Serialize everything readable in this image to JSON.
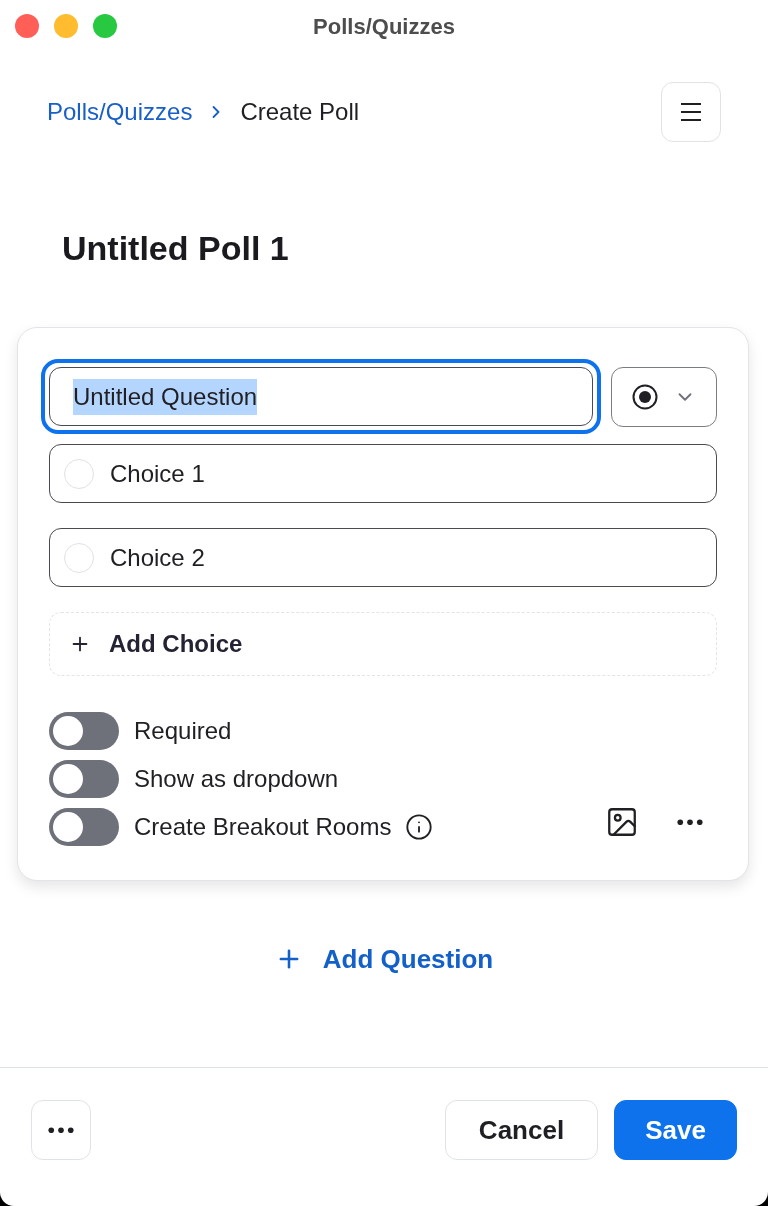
{
  "window": {
    "title": "Polls/Quizzes"
  },
  "breadcrumb": [
    {
      "label": "Polls/Quizzes",
      "kind": "link"
    },
    {
      "label": "Create Poll",
      "kind": "current"
    }
  ],
  "poll_title": "Untitled Poll 1",
  "question": {
    "value": "Untitled Question",
    "focused": true,
    "text_selected": true
  },
  "choices": [
    {
      "value": "Choice 1"
    },
    {
      "value": "Choice 2"
    }
  ],
  "add_choice": {
    "label": "Add Choice"
  },
  "options": [
    {
      "label": "Required",
      "on": false,
      "info": false
    },
    {
      "label": "Show as dropdown",
      "on": false,
      "info": false
    },
    {
      "label": "Create Breakout Rooms",
      "on": false,
      "info": true
    }
  ],
  "add_question": {
    "label": "Add Question"
  },
  "footer": {
    "buttons": [
      {
        "label": "Cancel",
        "kind": "secondary"
      },
      {
        "label": "Save",
        "kind": "primary"
      }
    ]
  }
}
